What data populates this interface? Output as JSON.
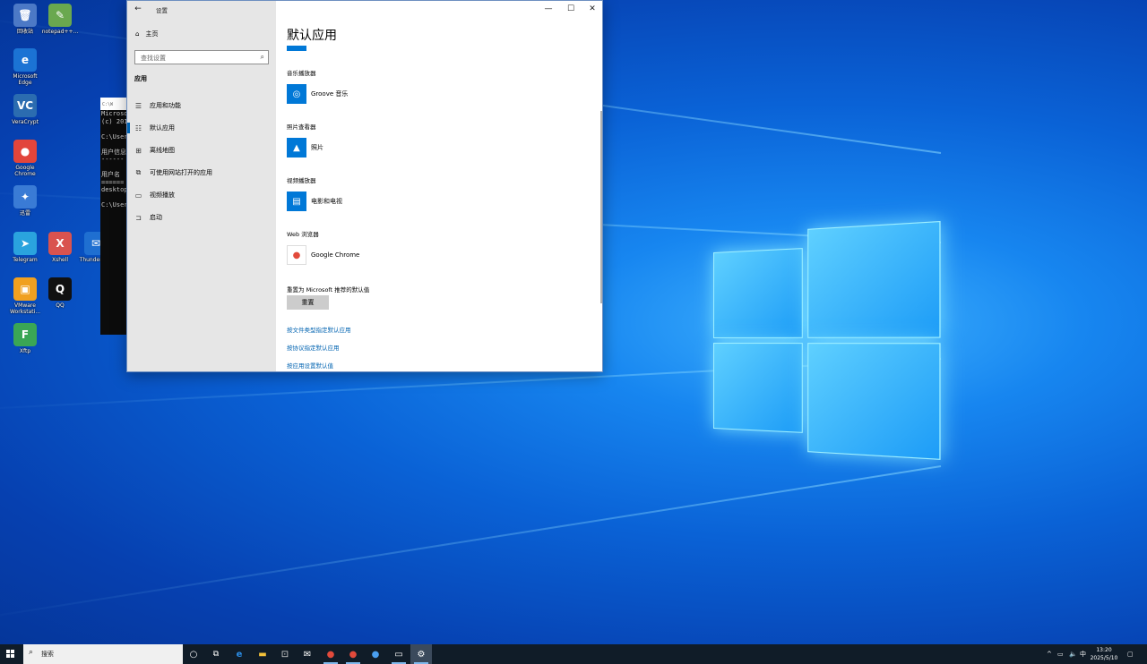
{
  "desktop": {
    "icons": [
      {
        "label": "回收站",
        "glyph": "🗑",
        "color": "#4c79c6"
      },
      {
        "label": "notepad++...",
        "glyph": "✎",
        "color": "#6aa84f"
      },
      {
        "label": "Microsoft Edge",
        "glyph": "e",
        "color": "#1b73d4"
      },
      {
        "label": "VeraCrypt",
        "glyph": "VC",
        "color": "#2b6cb0"
      },
      {
        "label": "Google Chrome",
        "glyph": "●",
        "color": "#e2453b"
      },
      {
        "label": "迅雷",
        "glyph": "✦",
        "color": "#3a7bd5"
      },
      {
        "label": "Telegram",
        "glyph": "➤",
        "color": "#2aa3de"
      },
      {
        "label": "Xshell",
        "glyph": "X",
        "color": "#d9534f"
      },
      {
        "label": "Thunderbird",
        "glyph": "✉",
        "color": "#1f6fd1"
      },
      {
        "label": "VMware Workstati...",
        "glyph": "▣",
        "color": "#f0a020"
      },
      {
        "label": "QQ",
        "glyph": "Q",
        "color": "#111111"
      },
      {
        "label": "Xftp",
        "glyph": "F",
        "color": "#3aa655"
      }
    ]
  },
  "console": {
    "title": "C:\\W",
    "lines": [
      "Microso",
      "(c) 201",
      "",
      "C:\\User",
      "",
      "用户信息",
      "------",
      "",
      "用户名",
      "======",
      "desktop",
      "",
      "C:\\User"
    ]
  },
  "settings": {
    "window_title": "设置",
    "back_icon": "←",
    "minimize": "—",
    "maximize": "☐",
    "close": "✕",
    "sidebar": {
      "home_label": "主页",
      "search_placeholder": "查找设置",
      "section": "应用",
      "items": [
        {
          "label": "应用和功能",
          "icon": "☰"
        },
        {
          "label": "默认应用",
          "icon": "☷"
        },
        {
          "label": "离线地图",
          "icon": "⊞"
        },
        {
          "label": "可使用网站打开的应用",
          "icon": "⧉"
        },
        {
          "label": "视频播放",
          "icon": "▭"
        },
        {
          "label": "启动",
          "icon": "⊐"
        }
      ]
    },
    "main": {
      "title": "默认应用",
      "categories": [
        {
          "heading": "音乐播放器",
          "app": "Groove 音乐",
          "icon": "◎"
        },
        {
          "heading": "照片查看器",
          "app": "照片",
          "icon": "▲"
        },
        {
          "heading": "视频播放器",
          "app": "电影和电视",
          "icon": "▤"
        },
        {
          "heading": "Web 浏览器",
          "app": "Google Chrome",
          "icon": "●"
        }
      ],
      "reset_heading": "重置为 Microsoft 推荐的默认值",
      "reset_button": "重置",
      "links": [
        "按文件类型指定默认应用",
        "按协议指定默认应用",
        "按应用设置默认值"
      ]
    }
  },
  "taskbar": {
    "search_placeholder": "搜索",
    "ime": "中",
    "time": "13:20",
    "date": "2025/5/10"
  }
}
